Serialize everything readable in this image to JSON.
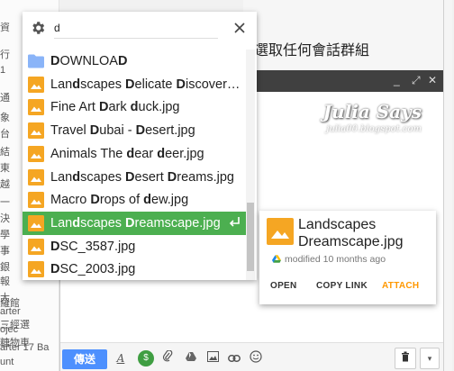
{
  "background": {
    "left_snippets": [
      "資",
      "行",
      "1",
      "通",
      "象",
      "台",
      "結",
      "東",
      "越",
      "一",
      "決",
      "學",
      "事",
      "銀",
      "報",
      "大",
      "arter",
      "ojec",
      "arter 17 Ba",
      "羅館",
      "三經選",
      "糖物車",
      "unt"
    ],
    "title": "選取任何會話群組",
    "window_controls": [
      "_",
      "⤢",
      "✕"
    ],
    "signature_title": "Julia Says",
    "signature_sub": "julia00.blogspot.com",
    "send_label": "傳送",
    "toolbar_icons": [
      "format-text-icon",
      "money-icon",
      "attach-icon",
      "drive-icon",
      "photo-icon",
      "link-icon",
      "emoji-icon"
    ]
  },
  "search": {
    "value": "d",
    "placeholder": ""
  },
  "results": [
    {
      "type": "folder",
      "name": "DOWNLOAD",
      "segments": [
        [
          "D",
          true
        ],
        [
          "OWNLOA",
          false
        ],
        [
          "D",
          true
        ]
      ]
    },
    {
      "type": "image",
      "name": "Landscapes Delicate Discovery...",
      "segments": [
        [
          "Lan",
          false
        ],
        [
          "d",
          true
        ],
        [
          "scapes ",
          false
        ],
        [
          "D",
          true
        ],
        [
          "elicate ",
          false
        ],
        [
          "D",
          true
        ],
        [
          "iscovery...",
          false
        ]
      ]
    },
    {
      "type": "image",
      "name": "Fine Art Dark duck.jpg",
      "segments": [
        [
          "Fine Art ",
          false
        ],
        [
          "D",
          true
        ],
        [
          "ark ",
          false
        ],
        [
          "d",
          true
        ],
        [
          "uck.jpg",
          false
        ]
      ]
    },
    {
      "type": "image",
      "name": "Travel Dubai - Desert.jpg",
      "segments": [
        [
          "Travel ",
          false
        ],
        [
          "D",
          true
        ],
        [
          "ubai - ",
          false
        ],
        [
          "D",
          true
        ],
        [
          "esert.jpg",
          false
        ]
      ]
    },
    {
      "type": "image",
      "name": "Animals The dear deer.jpg",
      "segments": [
        [
          "Animals The ",
          false
        ],
        [
          "d",
          true
        ],
        [
          "ear ",
          false
        ],
        [
          "d",
          true
        ],
        [
          "eer.jpg",
          false
        ]
      ]
    },
    {
      "type": "image",
      "name": "Landscapes Desert Dreams.jpg",
      "segments": [
        [
          "Lan",
          false
        ],
        [
          "d",
          true
        ],
        [
          "scapes ",
          false
        ],
        [
          "D",
          true
        ],
        [
          "esert ",
          false
        ],
        [
          "D",
          true
        ],
        [
          "reams.jpg",
          false
        ]
      ]
    },
    {
      "type": "image",
      "name": "Macro Drops of dew.jpg",
      "segments": [
        [
          "Macro ",
          false
        ],
        [
          "D",
          true
        ],
        [
          "rops of ",
          false
        ],
        [
          "d",
          true
        ],
        [
          "ew.jpg",
          false
        ]
      ]
    },
    {
      "type": "image",
      "name": "Landscapes Dreamscape.jpg",
      "selected": true,
      "segments": [
        [
          "Lan",
          false
        ],
        [
          "d",
          true
        ],
        [
          "scapes ",
          false
        ],
        [
          "D",
          true
        ],
        [
          "reamscape.jpg",
          false
        ]
      ]
    },
    {
      "type": "image",
      "name": "DSC_3587.jpg",
      "segments": [
        [
          "D",
          true
        ],
        [
          "SC_3587.jpg",
          false
        ]
      ]
    },
    {
      "type": "image",
      "name": "DSC_2003.jpg",
      "segments": [
        [
          "D",
          true
        ],
        [
          "SC_2003.jpg",
          false
        ]
      ]
    }
  ],
  "preview": {
    "title": "Landscapes Dreamscape.jpg",
    "meta": "modified 10 months ago",
    "open_label": "OPEN",
    "copy_link_label": "COPY LINK",
    "attach_label": "ATTACH"
  },
  "colors": {
    "accent_orange": "#ff9800",
    "selected_green": "#4caf50",
    "folder_blue": "#8ab4f8",
    "image_orange": "#f5a623",
    "send_blue": "#4d90fe"
  },
  "icons": {
    "settings": "gear-icon",
    "close": "close-icon",
    "folder": "folder-icon",
    "image": "image-file-icon",
    "enter": "enter-arrow-icon",
    "drive": "drive-icon"
  }
}
